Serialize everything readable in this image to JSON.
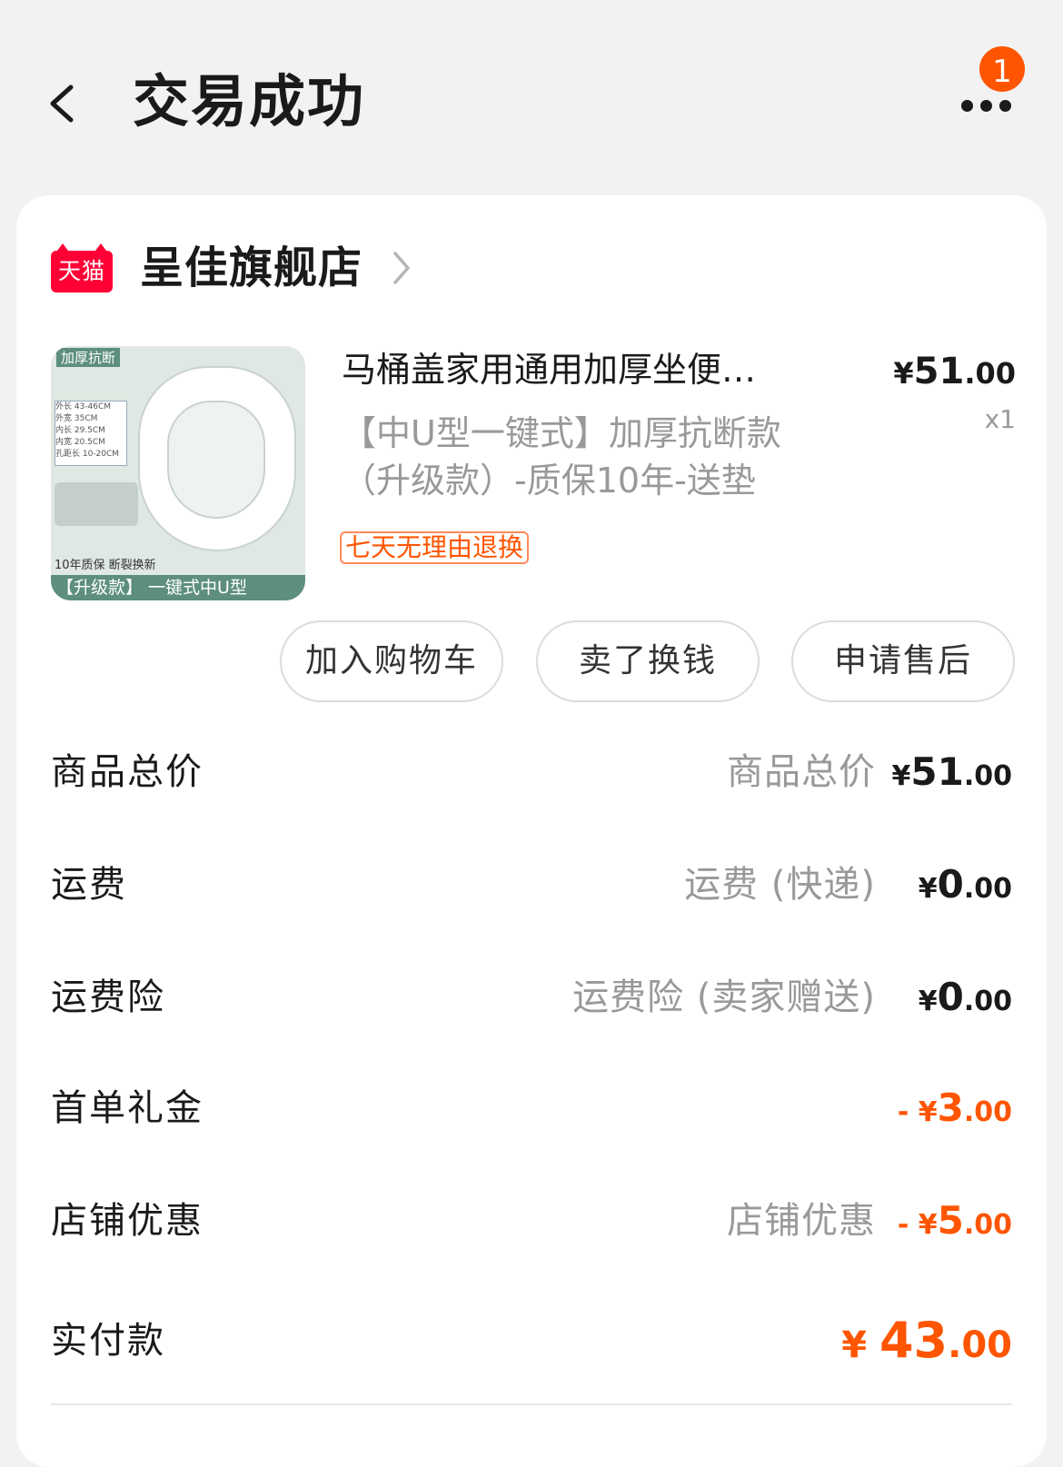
{
  "header": {
    "title": "交易成功",
    "notification_count": "1"
  },
  "store": {
    "logo_text": "天猫",
    "name": "呈佳旗舰店"
  },
  "product": {
    "title": "马桶盖家用通用加厚坐便…",
    "spec_line1": "【中U型一键式】加厚抗断款",
    "spec_line2": "（升级款）-质保10年-送垫",
    "price_currency": "¥",
    "price_int": "51",
    "price_dec": ".00",
    "quantity": "x1",
    "tag": "七天无理由退换",
    "image": {
      "top_label": "加厚抗断",
      "caption": "10年质保 断裂换新",
      "bottom_bar": "【升级款】 一键式中U型",
      "table": [
        "外长 43-46CM",
        "外宽 35CM",
        "内长 29.5CM",
        "内宽 20.5CM",
        "孔距长 10-20CM"
      ]
    }
  },
  "actions": {
    "add_cart": "加入购物车",
    "resell": "卖了换钱",
    "after_sale": "申请售后"
  },
  "summary": [
    {
      "label": "商品总价",
      "desc": "商品总价",
      "prefix": "",
      "currency": "¥",
      "int": "51",
      "dec": ".00",
      "kind": "normal"
    },
    {
      "label": "运费",
      "desc": "运费 (快递)",
      "prefix": "",
      "currency": "¥",
      "int": "0",
      "dec": ".00",
      "kind": "normal"
    },
    {
      "label": "运费险",
      "desc": "运费险 (卖家赠送)",
      "prefix": "",
      "currency": "¥",
      "int": "0",
      "dec": ".00",
      "kind": "normal"
    },
    {
      "label": "首单礼金",
      "desc": "",
      "prefix": "- ",
      "currency": "¥",
      "int": "3",
      "dec": ".00",
      "kind": "neg"
    },
    {
      "label": "店铺优惠",
      "desc": "店铺优惠",
      "prefix": "- ",
      "currency": "¥",
      "int": "5",
      "dec": ".00",
      "kind": "neg"
    },
    {
      "label": "实付款",
      "desc": "",
      "prefix": "",
      "currency": "¥ ",
      "int": "43",
      "dec": ".00",
      "kind": "total"
    }
  ],
  "colors": {
    "accent": "#ff5500",
    "tmall_red": "#ff0036",
    "muted_text": "#999999",
    "background": "#f2f2f2"
  }
}
